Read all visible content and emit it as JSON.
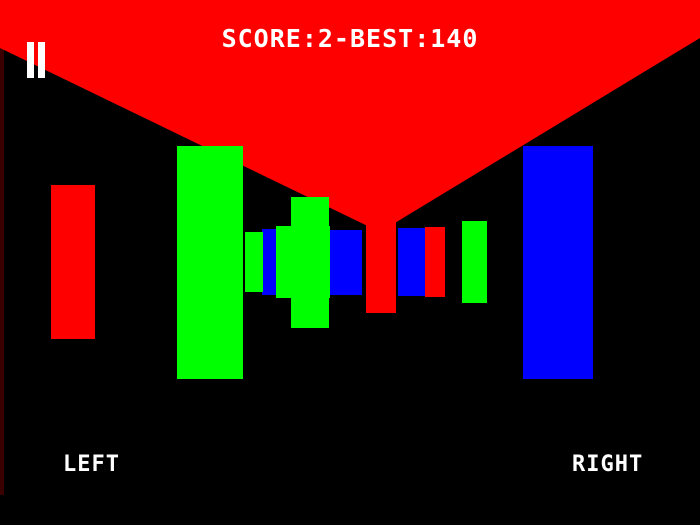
{
  "hud": {
    "score_text": "SCORE:2-BEST:140",
    "left_label": "LEFT",
    "right_label": "RIGHT",
    "pause_icon": "pause-icon"
  },
  "colors": {
    "background": "#000000",
    "ceiling": "#ff0000",
    "red": "#ff0000",
    "green": "#00ff00",
    "blue": "#0000ff",
    "text": "#ffffff"
  },
  "obstacles": [
    {
      "name": "near-green-pillar",
      "color": "green"
    },
    {
      "name": "near-blue-pillar",
      "color": "blue"
    },
    {
      "name": "left-red-pillar",
      "color": "red"
    },
    {
      "name": "mid-green-pillar",
      "color": "green"
    },
    {
      "name": "mid-green-pillar-right",
      "color": "green"
    },
    {
      "name": "far-green-pillar",
      "color": "green"
    },
    {
      "name": "far-blue-pillar-left",
      "color": "blue"
    },
    {
      "name": "far-blue-pillar-center",
      "color": "blue"
    },
    {
      "name": "far-red-pillar-center",
      "color": "red"
    },
    {
      "name": "far-blue-pillar-right",
      "color": "blue"
    },
    {
      "name": "far-red-pillar-right",
      "color": "red"
    }
  ]
}
